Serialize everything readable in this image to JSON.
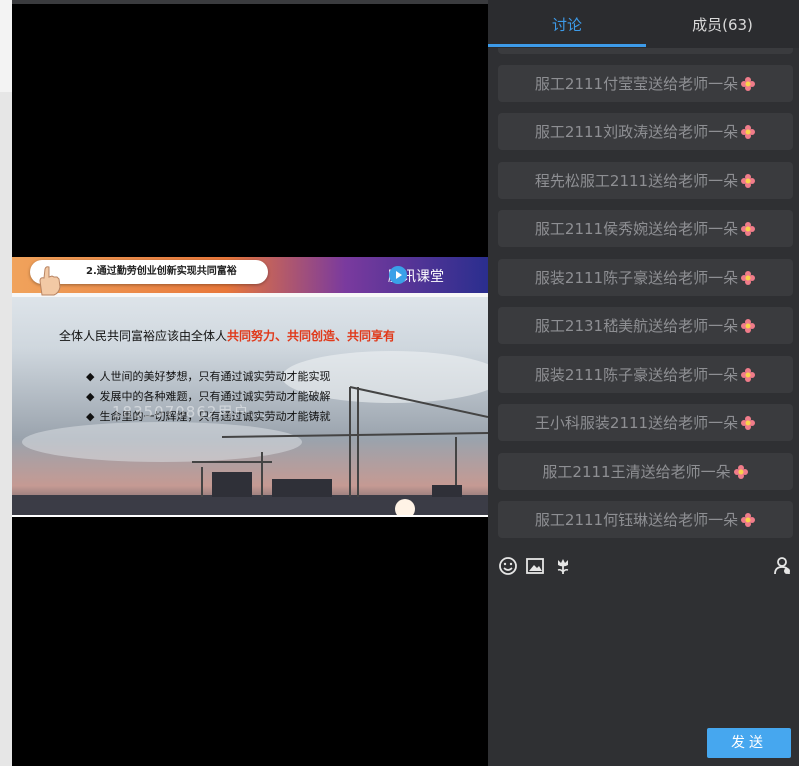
{
  "slide": {
    "title": "2.通过勤劳创业创新实现共同富裕",
    "brand": "腾讯课堂",
    "lead_plain": "全体人民共同富裕应该由全体人",
    "lead_highlight": "共同努力、共同创造、共同享有",
    "bullets": [
      "人世间的美好梦想，只有通过诚实劳动才能实现",
      "发展中的各种难题，只有通过诚实劳动才能破解",
      "生命里的一切辉煌，只有通过诚实劳动才能铸就"
    ],
    "watermark": "1835070862用户..."
  },
  "tabs": {
    "discuss": "讨论",
    "members": "成员(63)"
  },
  "messages": [
    "服工2111付莹莹送给老师一朵",
    "服工2111刘政涛送给老师一朵",
    "程先松服工2111送给老师一朵",
    "服工2111侯秀婉送给老师一朵",
    "服装2111陈子豪送给老师一朵",
    "服工2131嵇美航送给老师一朵",
    "服装2111陈子豪送给老师一朵",
    "王小科服装2111送给老师一朵",
    "服工2111王清送给老师一朵",
    "服工2111何钰琳送给老师一朵"
  ],
  "toolbar_icons": [
    "emoji-icon",
    "image-icon",
    "flower-icon",
    "user-icon"
  ],
  "send_label": "发送",
  "colors": {
    "accent": "#3d9be9",
    "send": "#46a7ef",
    "highlight": "#e0391a"
  }
}
